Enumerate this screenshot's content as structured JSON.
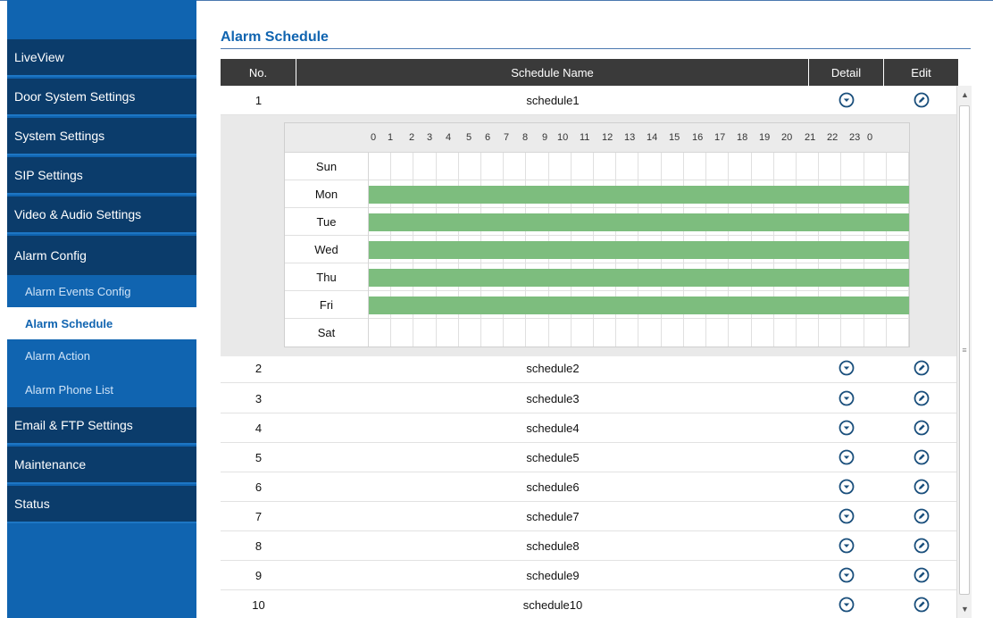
{
  "sidebar": {
    "items": [
      {
        "label": "LiveView"
      },
      {
        "label": "Door System Settings"
      },
      {
        "label": "System Settings"
      },
      {
        "label": "SIP Settings"
      },
      {
        "label": "Video & Audio Settings"
      },
      {
        "label": "Alarm Config"
      },
      {
        "label": "Email & FTP Settings"
      },
      {
        "label": "Maintenance"
      },
      {
        "label": "Status"
      }
    ],
    "subitems": [
      {
        "label": "Alarm Events Config"
      },
      {
        "label": "Alarm Schedule",
        "active": true
      },
      {
        "label": "Alarm Action"
      },
      {
        "label": "Alarm Phone List"
      }
    ]
  },
  "page": {
    "title": "Alarm Schedule"
  },
  "table": {
    "headers": {
      "no": "No.",
      "name": "Schedule Name",
      "detail": "Detail",
      "edit": "Edit"
    },
    "rows": [
      {
        "no": "1",
        "name": "schedule1"
      },
      {
        "no": "2",
        "name": "schedule2"
      },
      {
        "no": "3",
        "name": "schedule3"
      },
      {
        "no": "4",
        "name": "schedule4"
      },
      {
        "no": "5",
        "name": "schedule5"
      },
      {
        "no": "6",
        "name": "schedule6"
      },
      {
        "no": "7",
        "name": "schedule7"
      },
      {
        "no": "8",
        "name": "schedule8"
      },
      {
        "no": "9",
        "name": "schedule9"
      },
      {
        "no": "10",
        "name": "schedule10"
      }
    ]
  },
  "schedule_detail": {
    "hours": [
      "0",
      "1",
      "2",
      "3",
      "4",
      "5",
      "6",
      "7",
      "8",
      "9",
      "10",
      "11",
      "12",
      "13",
      "14",
      "15",
      "16",
      "17",
      "18",
      "19",
      "20",
      "21",
      "22",
      "23",
      "0"
    ],
    "days": [
      {
        "label": "Sun",
        "active": false
      },
      {
        "label": "Mon",
        "active": true
      },
      {
        "label": "Tue",
        "active": true
      },
      {
        "label": "Wed",
        "active": true
      },
      {
        "label": "Thu",
        "active": true
      },
      {
        "label": "Fri",
        "active": true
      },
      {
        "label": "Sat",
        "active": false
      }
    ]
  },
  "icons": {
    "detail": "chevron-down-circle-icon",
    "edit": "pencil-circle-icon"
  },
  "colors": {
    "sidebar_bg": "#1064b0",
    "nav_main_bg": "#0b3c6b",
    "accent": "#1064b0",
    "table_header": "#3a3a3a",
    "schedule_active": "#7dbd7e",
    "icon": "#1a4f7c"
  }
}
